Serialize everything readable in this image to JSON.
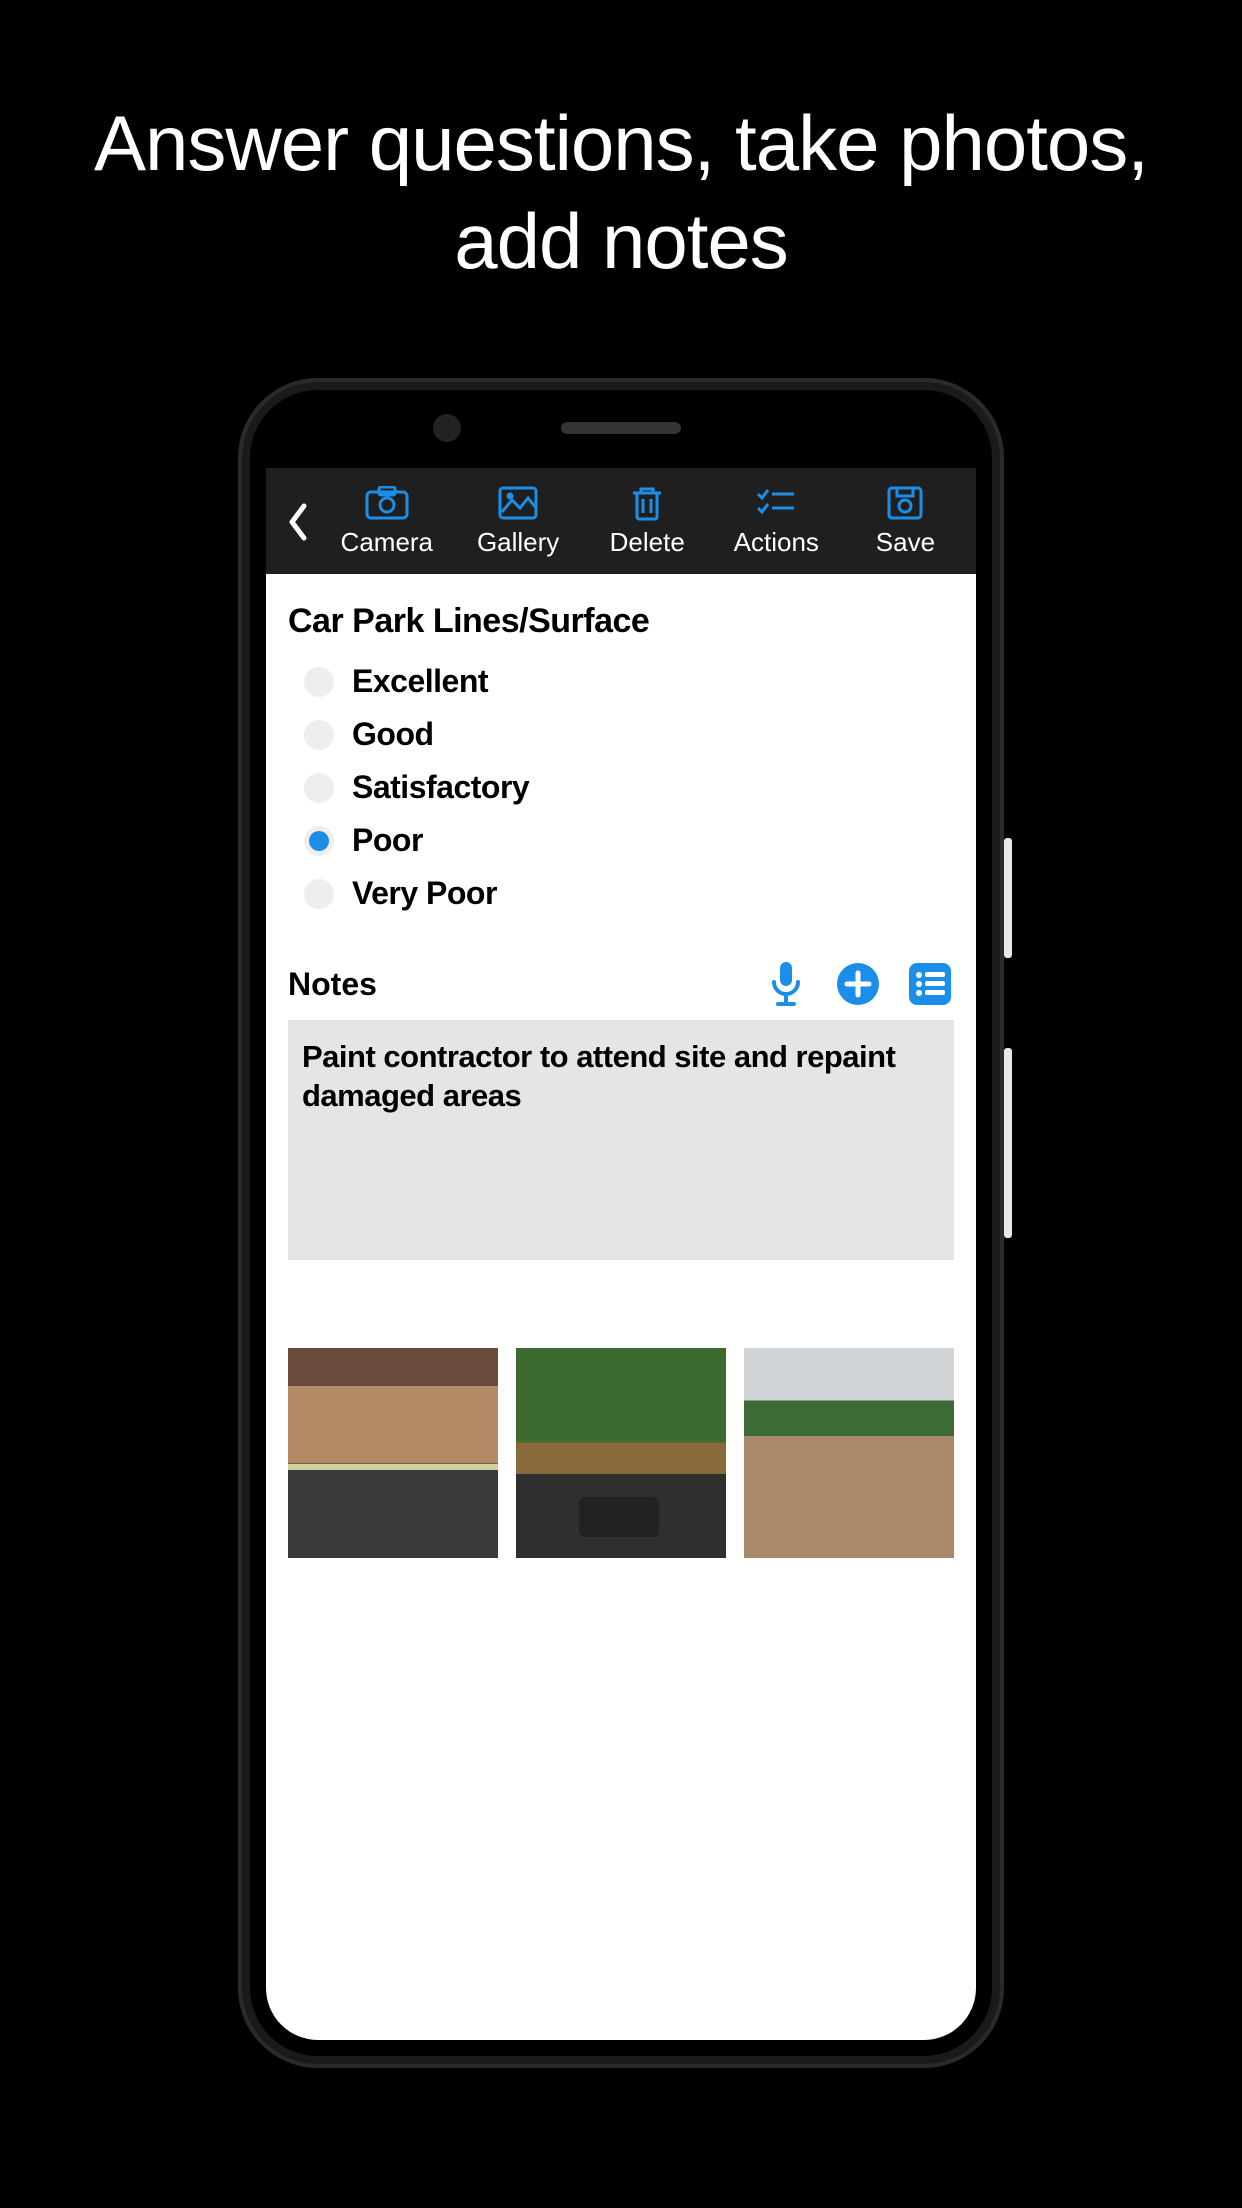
{
  "promo": {
    "line": "Answer questions, take photos, add notes"
  },
  "header": {
    "back": "Back",
    "toolbar": {
      "camera": "Camera",
      "gallery": "Gallery",
      "delete": "Delete",
      "actions": "Actions",
      "save": "Save"
    }
  },
  "question": {
    "title": "Car Park Lines/Surface",
    "options": [
      {
        "label": "Excellent",
        "selected": false
      },
      {
        "label": "Good",
        "selected": false
      },
      {
        "label": "Satisfactory",
        "selected": false
      },
      {
        "label": "Poor",
        "selected": true
      },
      {
        "label": "Very Poor",
        "selected": false
      }
    ]
  },
  "notes": {
    "title": "Notes",
    "text": "Paint contractor to attend site and repaint damaged areas",
    "action_icons": {
      "mic": "microphone-icon",
      "add": "plus-circle-icon",
      "list": "preset-list-icon"
    }
  },
  "photos": [
    {
      "name": "photo-1",
      "date_overlay": ""
    },
    {
      "name": "photo-2",
      "date_overlay": ""
    },
    {
      "name": "photo-3",
      "date_overlay": ""
    }
  ],
  "colors": {
    "accent": "#1b8fe8"
  }
}
